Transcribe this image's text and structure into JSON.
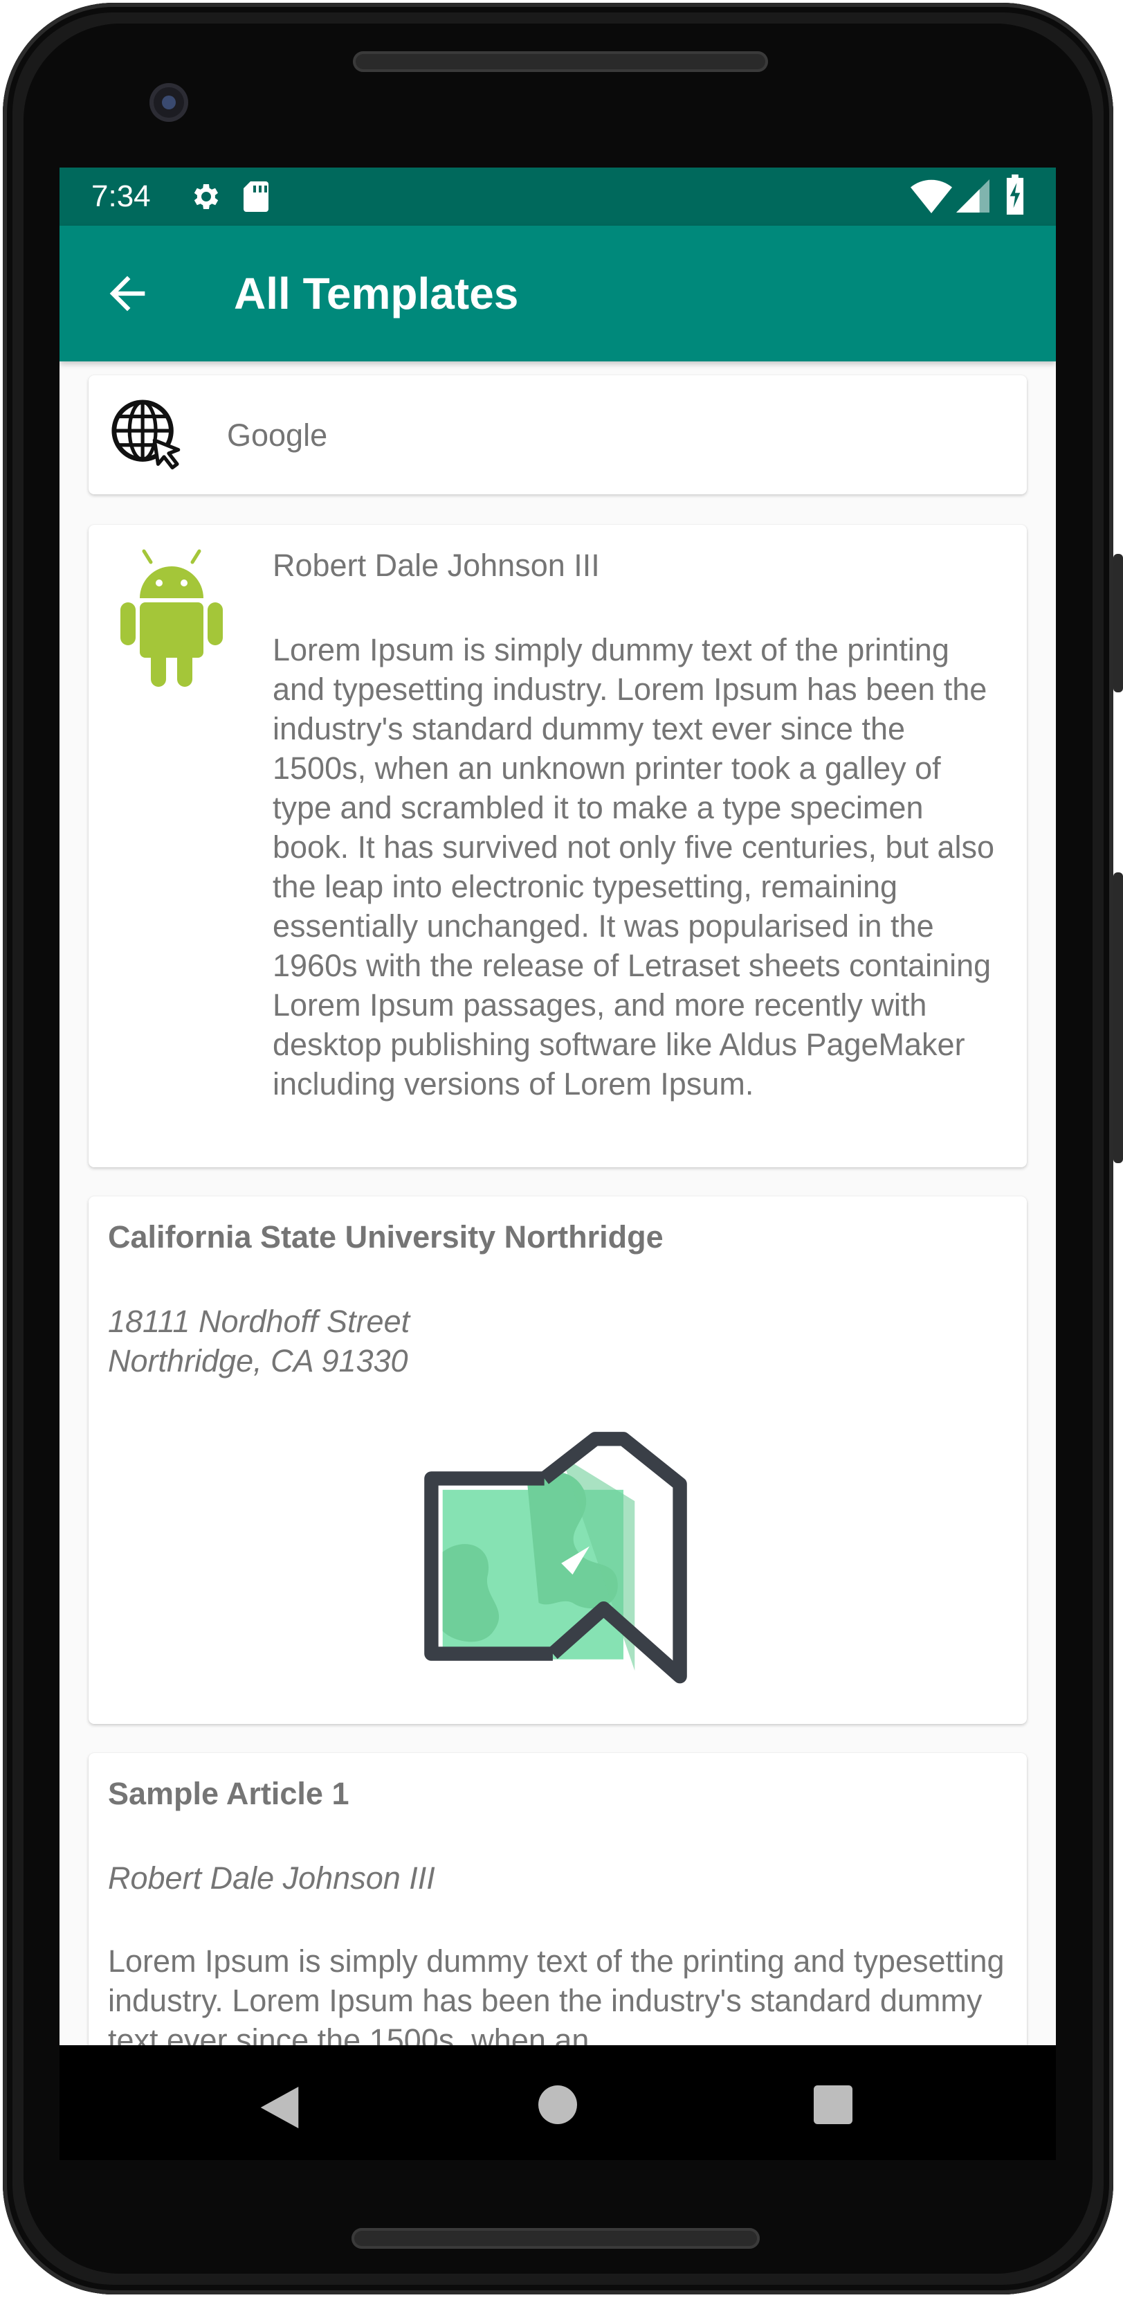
{
  "status_bar": {
    "time": "7:34",
    "left_icons": [
      "settings-icon",
      "sd-card-icon"
    ],
    "right_icons": [
      "wifi-icon",
      "cell-signal-icon",
      "battery-charging-icon"
    ],
    "background": "#00695c"
  },
  "app_bar": {
    "title": "All Templates",
    "back_icon": "arrow-back-icon",
    "background": "#00897b"
  },
  "cards": [
    {
      "type": "link",
      "icon": "globe-cursor-icon",
      "label": "Google"
    },
    {
      "type": "contact",
      "icon": "android-icon",
      "name": "Robert Dale Johnson III",
      "body": "Lorem Ipsum is simply dummy text of the printing and typesetting industry. Lorem Ipsum has been the industry's standard dummy text ever since the 1500s, when an unknown printer took a galley of type and scrambled it to make a type specimen book. It has survived not only five centuries, but also the leap into electronic typesetting, remaining essentially unchanged. It was popularised in the 1960s with the release of Letraset sheets containing Lorem Ipsum passages, and more recently with desktop publishing software like Aldus PageMaker including versions of Lorem Ipsum."
    },
    {
      "type": "location",
      "title": "California State University Northridge",
      "address_line1": "18111 Nordhoff Street",
      "address_line2": "Northridge, CA 91330",
      "icon": "map-icon"
    },
    {
      "type": "article",
      "title": "Sample Article 1",
      "author": "Robert Dale Johnson III",
      "body": "Lorem Ipsum is simply dummy text of the printing and typesetting industry. Lorem Ipsum has been the industry's standard dummy text ever since the 1500s, when an"
    }
  ],
  "nav_bar": {
    "buttons": [
      "back-triangle-icon",
      "home-circle-icon",
      "recents-square-icon"
    ]
  },
  "colors": {
    "accent": "#00897b",
    "text_secondary": "#757575",
    "android_green": "#a4c639",
    "map_green": "#86e2b3"
  }
}
